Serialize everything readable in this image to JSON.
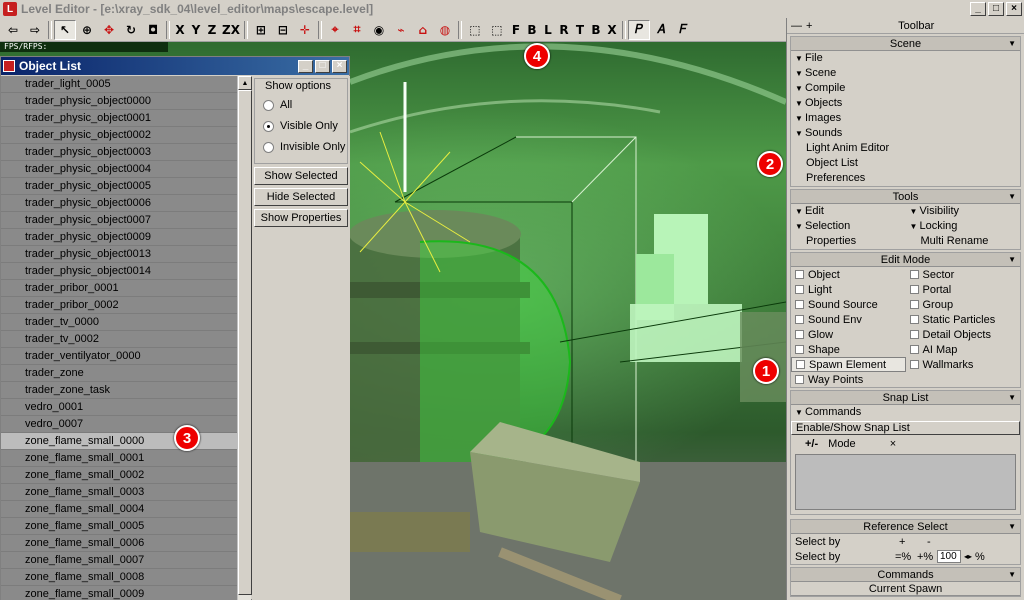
{
  "window": {
    "title": "Level Editor - [e:\\xray_sdk_04\\level_editor\\maps\\escape.level]",
    "icon": "L",
    "buttons": [
      "_",
      "□",
      "×"
    ]
  },
  "toolbar": {
    "items": [
      {
        "name": "undo-arrow",
        "glyph": "⇦"
      },
      {
        "name": "redo-arrow",
        "glyph": "⇨"
      },
      {
        "name": "sep"
      },
      {
        "name": "select-arrow",
        "glyph": "↖",
        "selected": true
      },
      {
        "name": "add-object",
        "glyph": "⊕"
      },
      {
        "name": "move",
        "glyph": "✥",
        "red": true
      },
      {
        "name": "rotate",
        "glyph": "↻"
      },
      {
        "name": "scale",
        "glyph": "◘"
      },
      {
        "name": "sep"
      },
      {
        "name": "axis-x",
        "glyph": "X"
      },
      {
        "name": "axis-y",
        "glyph": "Y"
      },
      {
        "name": "axis-z",
        "glyph": "Z"
      },
      {
        "name": "axis-zx",
        "glyph": "ZX"
      },
      {
        "name": "sep"
      },
      {
        "name": "snap-grid",
        "glyph": "⊞"
      },
      {
        "name": "snap-obj",
        "glyph": "⊟"
      },
      {
        "name": "snap-vert",
        "glyph": "✛",
        "red": true
      },
      {
        "name": "sep"
      },
      {
        "name": "snap-a",
        "glyph": "⌖",
        "red": true
      },
      {
        "name": "snap-b",
        "glyph": "⌗",
        "red": true
      },
      {
        "name": "snap-c",
        "glyph": "◉"
      },
      {
        "name": "snap-d",
        "glyph": "⌁",
        "red": true
      },
      {
        "name": "snap-e",
        "glyph": "⌂",
        "red": true
      },
      {
        "name": "snap-f",
        "glyph": "◍",
        "red": true
      },
      {
        "name": "sep"
      },
      {
        "name": "zoom-ext",
        "glyph": "⬚"
      },
      {
        "name": "zoom-sel",
        "glyph": "⬚"
      },
      {
        "name": "view-f",
        "glyph": "F"
      },
      {
        "name": "view-b",
        "glyph": "B"
      },
      {
        "name": "view-l",
        "glyph": "L"
      },
      {
        "name": "view-r",
        "glyph": "R"
      },
      {
        "name": "view-t",
        "glyph": "T"
      },
      {
        "name": "view-b2",
        "glyph": "B"
      },
      {
        "name": "view-x",
        "glyph": "X"
      },
      {
        "name": "sep"
      },
      {
        "name": "render-p",
        "glyph": "𝑃",
        "selected": true
      },
      {
        "name": "render-a",
        "glyph": "𝐴"
      },
      {
        "name": "render-f",
        "glyph": "𝐹"
      }
    ]
  },
  "viewport": {
    "fps_label": "FPS/RFPS:"
  },
  "object_list": {
    "title": "Object List",
    "items": [
      "trader_light_0005",
      "trader_physic_object0000",
      "trader_physic_object0001",
      "trader_physic_object0002",
      "trader_physic_object0003",
      "trader_physic_object0004",
      "trader_physic_object0005",
      "trader_physic_object0006",
      "trader_physic_object0007",
      "trader_physic_object0009",
      "trader_physic_object0013",
      "trader_physic_object0014",
      "trader_pribor_0001",
      "trader_pribor_0002",
      "trader_tv_0000",
      "trader_tv_0002",
      "trader_ventilyator_0000",
      "trader_zone",
      "trader_zone_task",
      "vedro_0001",
      "vedro_0007",
      "zone_flame_small_0000",
      "zone_flame_small_0001",
      "zone_flame_small_0002",
      "zone_flame_small_0003",
      "zone_flame_small_0004",
      "zone_flame_small_0005",
      "zone_flame_small_0006",
      "zone_flame_small_0007",
      "zone_flame_small_0008",
      "zone_flame_small_0009"
    ],
    "highlighted_index": 21,
    "show_options": {
      "label": "Show options",
      "radios": [
        {
          "label": "All",
          "checked": false
        },
        {
          "label": "Visible Only",
          "checked": true
        },
        {
          "label": "Invisible Only",
          "checked": false
        }
      ]
    },
    "buttons": [
      "Show Selected",
      "Hide Selected",
      "Show Properties"
    ]
  },
  "right_panel": {
    "toolbar_title": "Toolbar",
    "scene": {
      "title": "Scene",
      "menus": [
        "File",
        "Scene",
        "Compile",
        "Objects",
        "Images",
        "Sounds"
      ],
      "links": [
        "Light Anim Editor",
        "Object List",
        "Preferences"
      ]
    },
    "tools": {
      "title": "Tools",
      "left": [
        {
          "label": "Edit",
          "tri": true
        },
        {
          "label": "Selection",
          "tri": true
        },
        {
          "label": "Properties",
          "tri": false
        }
      ],
      "right": [
        {
          "label": "Visibility",
          "tri": true
        },
        {
          "label": "Locking",
          "tri": true
        },
        {
          "label": "Multi Rename",
          "tri": false
        }
      ]
    },
    "edit_mode": {
      "title": "Edit Mode",
      "left": [
        "Object",
        "Light",
        "Sound Source",
        "Sound Env",
        "Glow",
        "Shape",
        "Spawn Element",
        "Way Points"
      ],
      "right": [
        "Sector",
        "Portal",
        "Group",
        "Static Particles",
        "Detail Objects",
        "AI Map",
        "Wallmarks"
      ],
      "highlighted": "Spawn Element"
    },
    "snap_list": {
      "title": "Snap List",
      "commands_label": "Commands",
      "enable_label": "Enable/Show Snap List",
      "mode_label": "Mode",
      "mode_prefix": "+/-",
      "mode_close": "×"
    },
    "reference_select": {
      "title": "Reference Select",
      "row1_label": "Select by",
      "row1_plus": "+",
      "row1_minus": "-",
      "row2_label": "Select by",
      "row2_eq": "=%",
      "row2_plus": "+%",
      "row2_value": "100",
      "row2_unit": "%"
    },
    "commands_title": "Commands",
    "current_spawn": "Current Spawn"
  },
  "callouts": [
    "1",
    "2",
    "3",
    "4"
  ],
  "colors": {
    "title_gradient_start": "#0a246a",
    "callout": "#ee0000"
  }
}
